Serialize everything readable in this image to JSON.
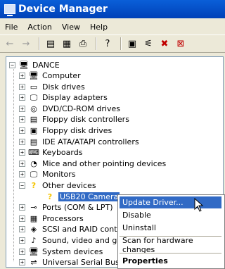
{
  "window": {
    "title": "Device Manager",
    "icon": "device-manager-icon"
  },
  "menubar": {
    "items": [
      "File",
      "Action",
      "View",
      "Help"
    ]
  },
  "toolbar": {
    "buttons": [
      {
        "name": "back-button",
        "glyph": "←"
      },
      {
        "name": "forward-button",
        "glyph": "→"
      },
      {
        "name": "show-hide-tree-button",
        "glyph": "▤"
      },
      {
        "name": "properties-button",
        "glyph": "▦"
      },
      {
        "name": "print-button",
        "glyph": "⎙"
      },
      {
        "name": "help-button",
        "glyph": "?"
      },
      {
        "name": "scan-hardware-button",
        "glyph": "▣"
      },
      {
        "name": "update-driver-button",
        "glyph": "⚟"
      },
      {
        "name": "uninstall-button",
        "glyph": "✖"
      },
      {
        "name": "disable-button",
        "glyph": "⊠"
      }
    ]
  },
  "tree": {
    "root": "DANCE",
    "items": [
      {
        "label": "Computer",
        "icon": "computer-icon",
        "glyph": "🖥"
      },
      {
        "label": "Disk drives",
        "icon": "disk-drive-icon",
        "glyph": "▭"
      },
      {
        "label": "Display adapters",
        "icon": "display-adapter-icon",
        "glyph": "🖵"
      },
      {
        "label": "DVD/CD-ROM drives",
        "icon": "cdrom-icon",
        "glyph": "◎"
      },
      {
        "label": "Floppy disk controllers",
        "icon": "controller-icon",
        "glyph": "▤"
      },
      {
        "label": "Floppy disk drives",
        "icon": "floppy-icon",
        "glyph": "▣"
      },
      {
        "label": "IDE ATA/ATAPI controllers",
        "icon": "controller-icon",
        "glyph": "▤"
      },
      {
        "label": "Keyboards",
        "icon": "keyboard-icon",
        "glyph": "⌨"
      },
      {
        "label": "Mice and other pointing devices",
        "icon": "mouse-icon",
        "glyph": "◔"
      },
      {
        "label": "Monitors",
        "icon": "monitor-icon",
        "glyph": "🖵"
      },
      {
        "label": "Other devices",
        "icon": "unknown-device-icon",
        "glyph": "?",
        "expanded": true
      },
      {
        "label": "USB20 Camera",
        "icon": "warning-device-icon",
        "glyph": "?",
        "child": true,
        "selected": true
      },
      {
        "label": "Ports (COM & LPT)",
        "icon": "port-icon",
        "glyph": "⊸"
      },
      {
        "label": "Processors",
        "icon": "processor-icon",
        "glyph": "▦"
      },
      {
        "label": "SCSI and RAID controllers",
        "icon": "scsi-icon",
        "glyph": "◈"
      },
      {
        "label": "Sound, video and game controllers",
        "icon": "sound-icon",
        "glyph": "♪"
      },
      {
        "label": "System devices",
        "icon": "system-device-icon",
        "glyph": "🖥"
      },
      {
        "label": "Universal Serial Bus controllers",
        "icon": "usb-icon",
        "glyph": "⇌"
      }
    ]
  },
  "context_menu": {
    "items": [
      {
        "label": "Update Driver...",
        "highlighted": true
      },
      {
        "label": "Disable"
      },
      {
        "label": "Uninstall"
      },
      {
        "separator": true
      },
      {
        "label": "Scan for hardware changes"
      },
      {
        "separator": true
      },
      {
        "label": "Properties",
        "bold": true
      }
    ]
  },
  "colors": {
    "title_bar": "#0a5fd8",
    "selection": "#316ac5",
    "warning": "#f5c400"
  }
}
